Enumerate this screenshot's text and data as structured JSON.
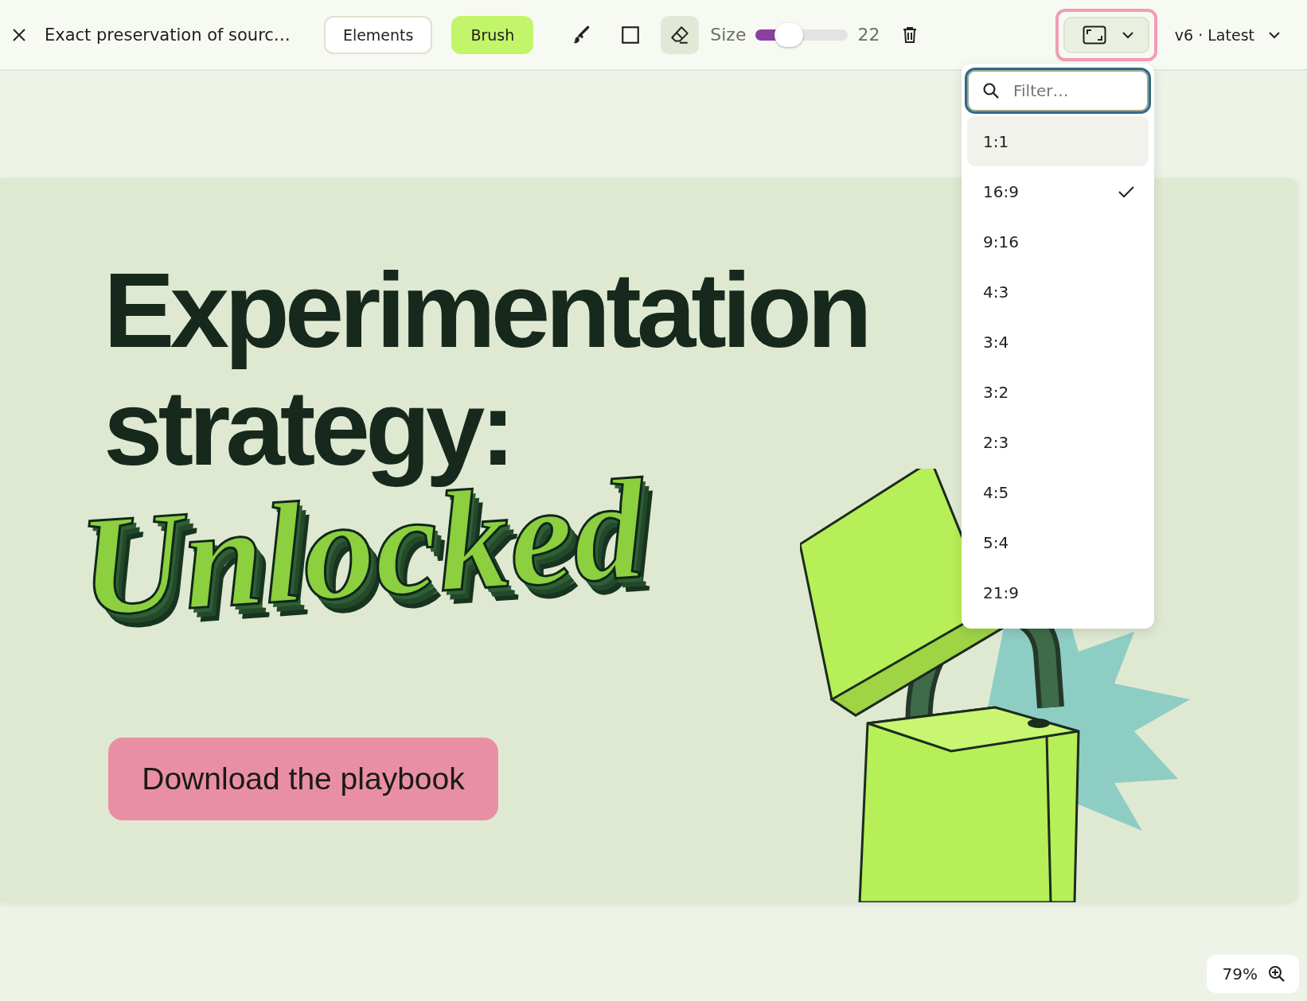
{
  "title": "Exact preservation of sourc…",
  "modes": [
    {
      "label": "Elements",
      "selected": false
    },
    {
      "label": "Brush",
      "selected": true
    }
  ],
  "tools": [
    {
      "kind": "brush",
      "selected": false
    },
    {
      "kind": "rectangle",
      "selected": false
    },
    {
      "kind": "eraser",
      "selected": true
    }
  ],
  "size": {
    "label": "Size",
    "level": 0.3,
    "reading": "22"
  },
  "aspect_button": {
    "highlighted": true
  },
  "version": "v6 · Latest",
  "dropdown": {
    "placeholder": "Filter…",
    "items": [
      {
        "label": "1:1",
        "hovered": true,
        "selected": false
      },
      {
        "label": "16:9",
        "hovered": false,
        "selected": true
      },
      {
        "label": "9:16",
        "hovered": false,
        "selected": false
      },
      {
        "label": "4:3",
        "hovered": false,
        "selected": false
      },
      {
        "label": "3:4",
        "hovered": false,
        "selected": false
      },
      {
        "label": "3:2",
        "hovered": false,
        "selected": false
      },
      {
        "label": "2:3",
        "hovered": false,
        "selected": false
      },
      {
        "label": "4:5",
        "hovered": false,
        "selected": false
      },
      {
        "label": "5:4",
        "hovered": false,
        "selected": false
      },
      {
        "label": "21:9",
        "hovered": false,
        "selected": false
      }
    ]
  },
  "banner": {
    "headline": [
      "Experimentation",
      "strategy:"
    ],
    "script": "Unlocked",
    "button": "Download the playbook"
  },
  "zoom": "79%"
}
